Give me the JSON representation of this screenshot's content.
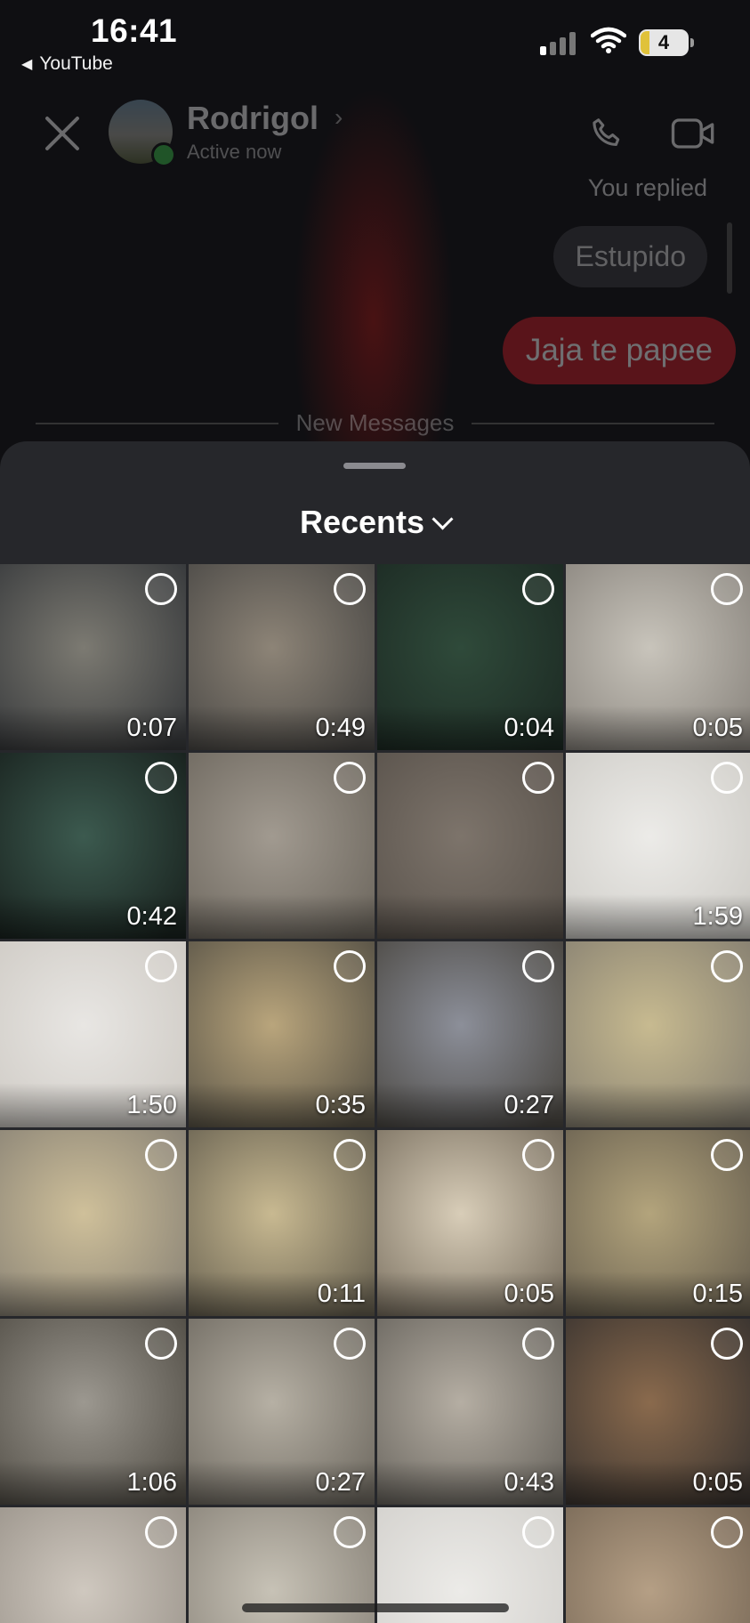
{
  "status_bar": {
    "time": "16:41",
    "back_app": "YouTube",
    "battery": "4"
  },
  "chat": {
    "contact_name": "Rodrigol",
    "active_status": "Active now",
    "you_replied": "You replied",
    "replied_message": "Estupido",
    "sent_message": "Jaja te papee",
    "divider_label": "New Messages"
  },
  "sheet": {
    "title": "Recents"
  },
  "media": [
    {
      "duration": "0:07",
      "colors": [
        "#7c7a72",
        "#3a3c3e"
      ]
    },
    {
      "duration": "0:49",
      "colors": [
        "#8d8477",
        "#4c4a47"
      ]
    },
    {
      "duration": "0:04",
      "colors": [
        "#2f4a3a",
        "#1d2b24"
      ]
    },
    {
      "duration": "0:05",
      "colors": [
        "#c8c4bb",
        "#8c8780"
      ]
    },
    {
      "duration": "0:42",
      "colors": [
        "#3c5a4f",
        "#1a2420"
      ]
    },
    {
      "duration": "",
      "colors": [
        "#a19a90",
        "#6f6960"
      ]
    },
    {
      "duration": "",
      "colors": [
        "#7d746b",
        "#5a534c"
      ]
    },
    {
      "duration": "1:59",
      "colors": [
        "#ecebe8",
        "#cfcdc8"
      ]
    },
    {
      "duration": "1:50",
      "colors": [
        "#e8e6e3",
        "#cfcbc5"
      ]
    },
    {
      "duration": "0:35",
      "colors": [
        "#b9a57c",
        "#5d5749"
      ]
    },
    {
      "duration": "0:27",
      "colors": [
        "#8c8f99",
        "#4d4a45"
      ]
    },
    {
      "duration": "",
      "colors": [
        "#c7ba90",
        "#8a8373"
      ]
    },
    {
      "duration": "",
      "colors": [
        "#cfc09a",
        "#8c8577"
      ]
    },
    {
      "duration": "0:11",
      "colors": [
        "#c8b991",
        "#6b6453"
      ]
    },
    {
      "duration": "0:05",
      "colors": [
        "#d8cdb8",
        "#7d7363"
      ]
    },
    {
      "duration": "0:15",
      "colors": [
        "#b3a47c",
        "#6c6352"
      ]
    },
    {
      "duration": "1:06",
      "colors": [
        "#9c9890",
        "#56524a"
      ]
    },
    {
      "duration": "0:27",
      "colors": [
        "#b6b0a4",
        "#726d64"
      ]
    },
    {
      "duration": "0:43",
      "colors": [
        "#b5aea3",
        "#6b6760"
      ]
    },
    {
      "duration": "0:05",
      "colors": [
        "#8a6a4d",
        "#3d3631"
      ]
    },
    {
      "duration": "",
      "colors": [
        "#cfc8bf",
        "#9c958c"
      ]
    },
    {
      "duration": "",
      "colors": [
        "#c7c2b6",
        "#8b857b"
      ]
    },
    {
      "duration": "",
      "colors": [
        "#ecebe8",
        "#d3d1cd"
      ]
    },
    {
      "duration": "",
      "colors": [
        "#b59f85",
        "#7a6a58"
      ]
    }
  ]
}
